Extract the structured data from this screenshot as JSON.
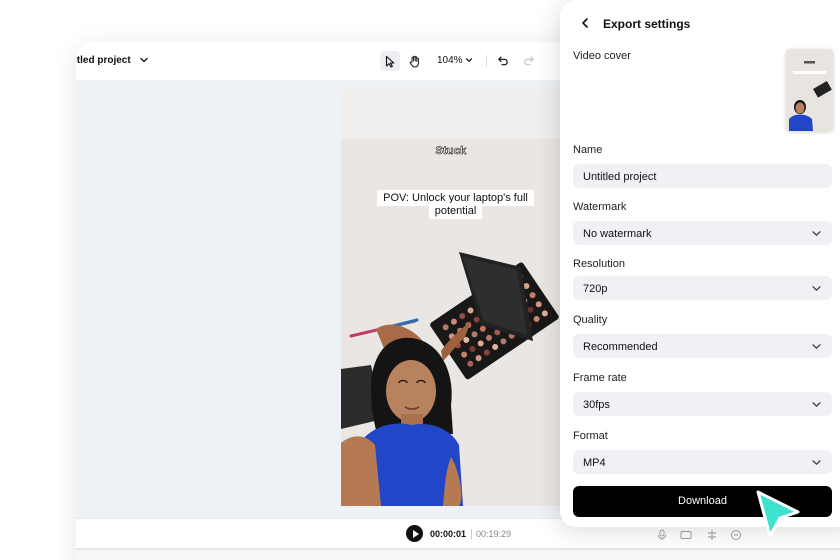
{
  "editor": {
    "project_name": "itled project",
    "zoom": "104%",
    "video": {
      "sticker_text": "Stuck",
      "caption": "POV: Unlock your laptop's full potential"
    },
    "playback": {
      "current_time": "00:00:01",
      "total_time": "00:19:29"
    }
  },
  "export_panel": {
    "title": "Export settings",
    "video_cover_label": "Video cover",
    "name_label": "Name",
    "name_value": "Untitled project",
    "watermark_label": "Watermark",
    "watermark_value": "No watermark",
    "resolution_label": "Resolution",
    "resolution_value": "720p",
    "quality_label": "Quality",
    "quality_value": "Recommended",
    "frame_rate_label": "Frame rate",
    "frame_rate_value": "30fps",
    "format_label": "Format",
    "format_value": "MP4",
    "download_label": "Download"
  },
  "icons": {
    "back": "chevron-left-icon",
    "dropdown": "chevron-down-icon",
    "select_tool": "pointer-icon",
    "hand_tool": "hand-icon",
    "undo": "undo-icon",
    "redo": "redo-icon",
    "play": "play-icon",
    "mouse_cursor": "cursor-arrow-icon"
  },
  "colors": {
    "accent_cursor": "#3ee3d0",
    "download_button": "#000000",
    "field_background": "#eff1f4",
    "canvas_background": "#eef1f5"
  }
}
